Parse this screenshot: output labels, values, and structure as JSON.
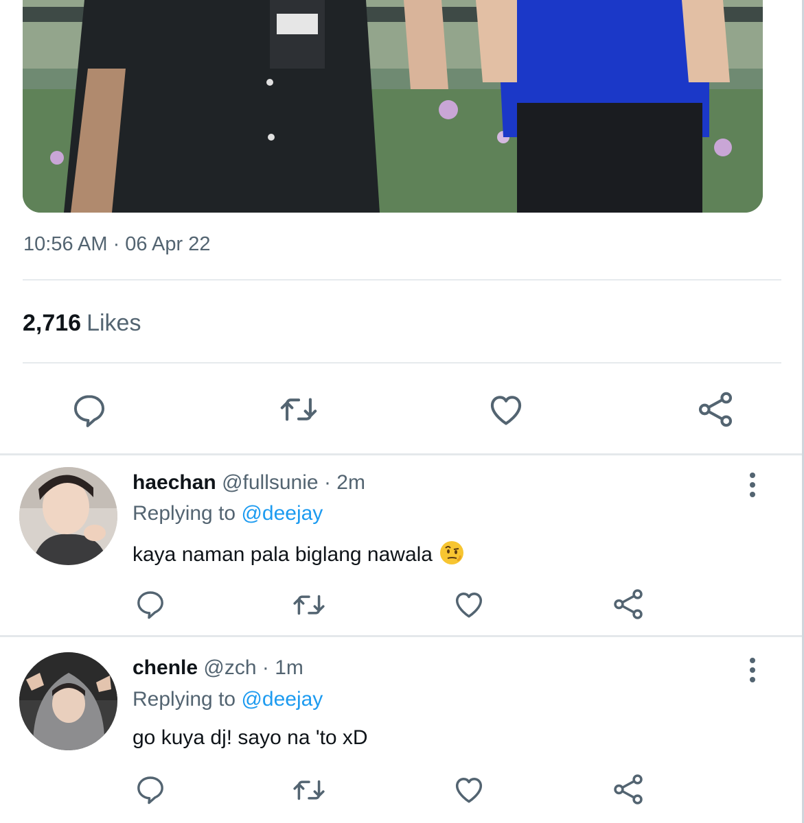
{
  "tweet": {
    "timestamp": "10:56 AM · 06 Apr 22",
    "likes_count": "2,716",
    "likes_label": "Likes",
    "actions": [
      "comment-icon",
      "retweet-icon",
      "heart-icon",
      "share-icon"
    ]
  },
  "replies": [
    {
      "name": "haechan",
      "handle": "@fullsunie",
      "time": "· 2m",
      "replying_prefix": "Replying to",
      "replying_to": "@deejay",
      "text": "kaya naman pala biglang nawala",
      "emoji": "raised-eyebrow-emoji"
    },
    {
      "name": "chenle",
      "handle": "@zch",
      "time": "· 1m",
      "replying_prefix": "Replying to",
      "replying_to": "@deejay",
      "text": "go kuya dj! sayo na 'to xD"
    }
  ],
  "colors": {
    "icon": "#536471",
    "mention": "#1d9bf0",
    "secondary_text": "#536471"
  }
}
